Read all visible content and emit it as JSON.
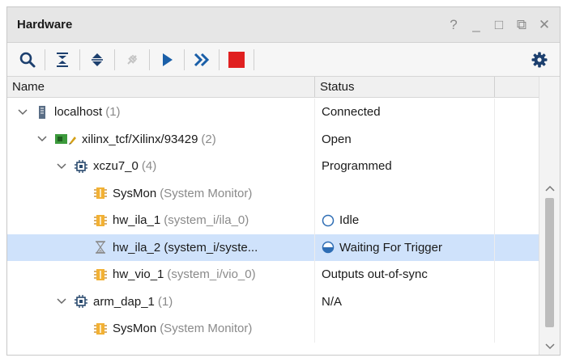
{
  "panel": {
    "title": "Hardware",
    "controls": {
      "help": "?",
      "minimize": "_",
      "maximize": "□",
      "restore": "⧉",
      "close": "✕"
    }
  },
  "toolbar": {
    "accent_play": "#1a5fa8",
    "accent_stop": "#e02020",
    "accent_gear": "#1c3f6e"
  },
  "table": {
    "headers": {
      "name": "Name",
      "status": "Status"
    },
    "rows": [
      {
        "indent": 0,
        "chevron": "expanded",
        "icon": "server-icon",
        "name": "localhost",
        "sub": "(1)",
        "status": "Connected",
        "status_icon": ""
      },
      {
        "indent": 1,
        "chevron": "expanded",
        "icon": "board-icon",
        "name": "xilinx_tcf/Xilinx/93429",
        "sub": "(2)",
        "status": "Open",
        "status_icon": ""
      },
      {
        "indent": 2,
        "chevron": "expanded",
        "icon": "chip-icon",
        "name": "xczu7_0",
        "sub": "(4)",
        "status": "Programmed",
        "status_icon": ""
      },
      {
        "indent": 3,
        "chevron": "none",
        "icon": "debug-core-icon",
        "name": "SysMon",
        "sub": "(System Monitor)",
        "status": "",
        "status_icon": ""
      },
      {
        "indent": 3,
        "chevron": "none",
        "icon": "debug-core-icon",
        "name": "hw_ila_1",
        "sub": "(system_i/ila_0)",
        "status": "Idle",
        "status_icon": "idle"
      },
      {
        "indent": 3,
        "chevron": "none",
        "icon": "hourglass-icon",
        "name": "hw_ila_2 (system_i/syste...",
        "sub": "",
        "status": "Waiting For Trigger",
        "status_icon": "waiting",
        "selected": true
      },
      {
        "indent": 3,
        "chevron": "none",
        "icon": "debug-core-icon",
        "name": "hw_vio_1",
        "sub": "(system_i/vio_0)",
        "status": "Outputs out-of-sync",
        "status_icon": ""
      },
      {
        "indent": 2,
        "chevron": "expanded",
        "icon": "chip-icon",
        "name": "arm_dap_1",
        "sub": "(1)",
        "status": "N/A",
        "status_icon": ""
      },
      {
        "indent": 3,
        "chevron": "none",
        "icon": "debug-core-icon",
        "name": "SysMon",
        "sub": "(System Monitor)",
        "status": "",
        "status_icon": ""
      }
    ]
  }
}
